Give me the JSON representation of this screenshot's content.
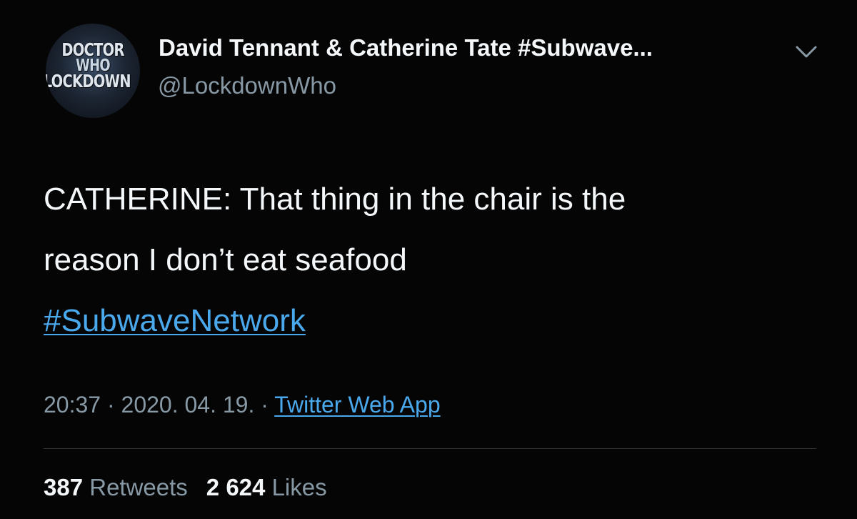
{
  "author": {
    "avatar_lines": [
      "DOCTOR",
      "WHO",
      "LOCKDOWN"
    ],
    "display_name": "David Tennant & Catherine Tate #Subwave...",
    "handle": "@LockdownWho",
    "menu_icon": "chevron-down-icon"
  },
  "tweet": {
    "lines": [
      "CATHERINE: That thing in the chair is the",
      "reason I don’t eat seafood"
    ],
    "hashtag": "#SubwaveNetwork"
  },
  "meta": {
    "time": "20:37",
    "separator": "·",
    "date": "2020. 04. 19.",
    "source": "Twitter Web App"
  },
  "stats": {
    "retweets_count": "387",
    "retweets_label": "Retweets",
    "likes_count": "2 624",
    "likes_label": "Likes"
  },
  "colors": {
    "background": "#050505",
    "text": "#f5f8fa",
    "secondary": "#8899a6",
    "link": "#4aa8ec",
    "divider": "#2f3336"
  }
}
